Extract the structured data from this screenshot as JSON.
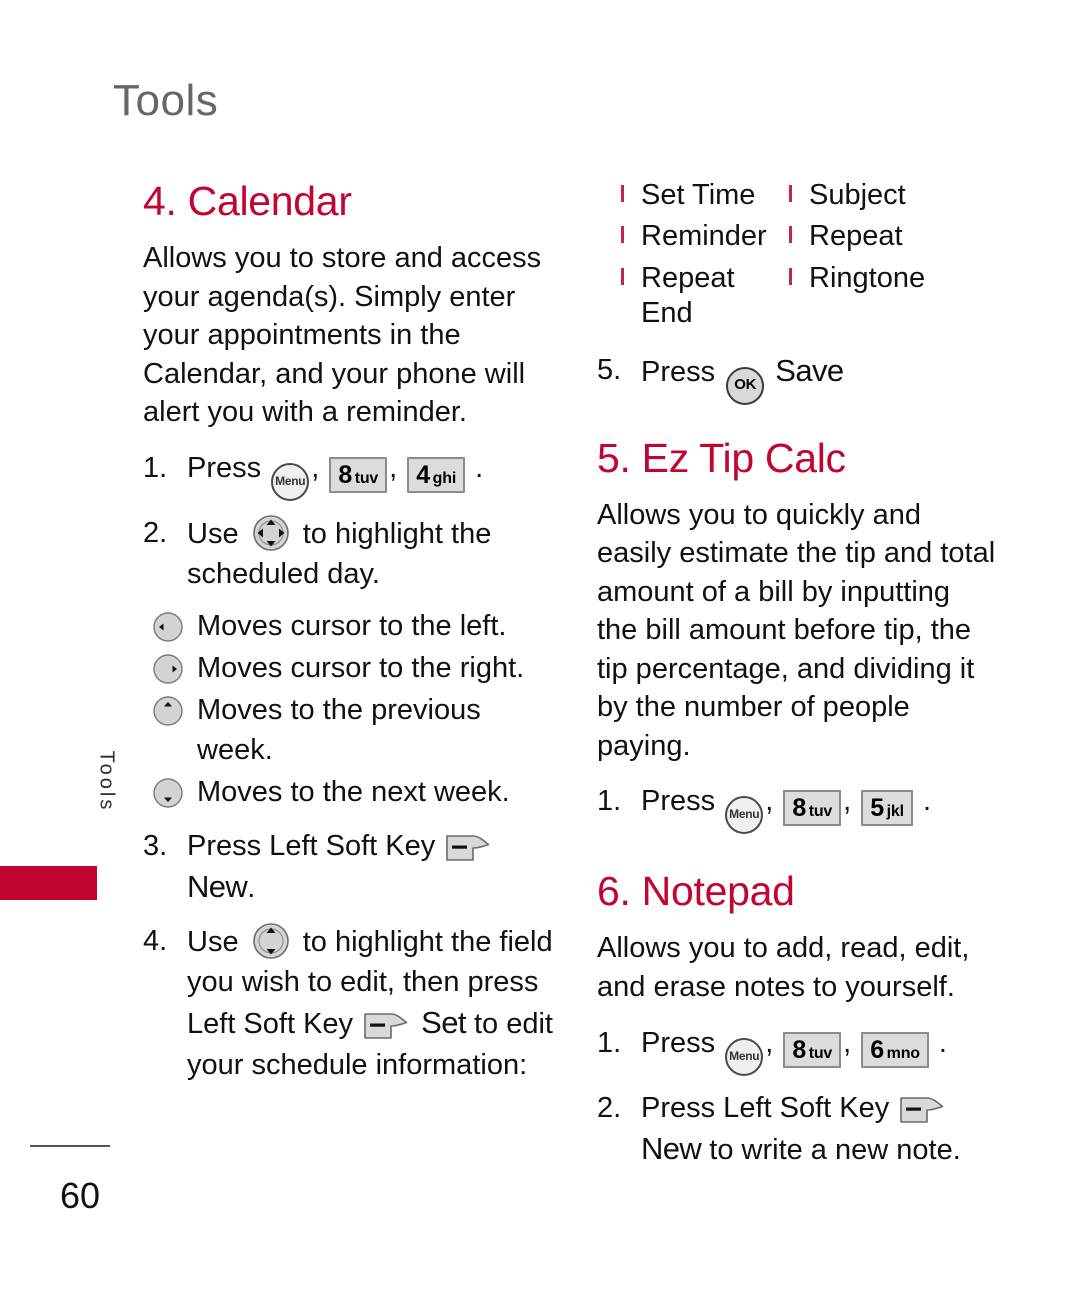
{
  "page": {
    "header_title": "Tools",
    "side_tab_label": "Tools",
    "page_number": "60",
    "accent_red": "#c20430",
    "header_grey": "#666666"
  },
  "calendar": {
    "heading": "4. Calendar",
    "intro": "Allows you to store and access your agenda(s). Simply enter your appointments in the Calendar, and your phone will alert you with a reminder.",
    "step1": {
      "num": "1.",
      "verb": "Press",
      "key_menu": "Menu",
      "key2_digit": "8",
      "key2_letters": "tuv",
      "key3_digit": "4",
      "key3_letters": "ghi",
      "comma": ",",
      "period": "."
    },
    "step2": {
      "num": "2.",
      "verb": "Use",
      "text": "to highlight the scheduled day."
    },
    "nav_items": [
      {
        "icon": "nav-left-icon",
        "text": "Moves cursor to the left."
      },
      {
        "icon": "nav-right-icon",
        "text": "Moves cursor to the right."
      },
      {
        "icon": "nav-up-icon",
        "text": "Moves to the previous week."
      },
      {
        "icon": "nav-down-icon",
        "text": "Moves to the next week."
      }
    ],
    "step3": {
      "num": "3.",
      "text_before": "Press Left Soft Key",
      "soft_label": "New",
      "text_after": "."
    },
    "step4": {
      "num": "4.",
      "verb": "Use",
      "text_mid": "to highlight the field you wish to edit, then press Left Soft Key",
      "soft_label": "Set",
      "text_after": "to edit your schedule information:"
    },
    "fields": [
      "Set Time",
      "Subject",
      "Reminder",
      "Repeat",
      "Repeat End",
      "Ringtone"
    ],
    "step5": {
      "num": "5.",
      "verb": "Press",
      "key_ok": "OK",
      "soft_label": "Save"
    }
  },
  "ez_tip_calc": {
    "heading": "5. Ez Tip Calc",
    "intro": "Allows you to quickly and easily estimate the tip and total amount of a bill by inputting the bill amount before tip, the tip percentage, and dividing it by the number of people paying.",
    "step1": {
      "num": "1.",
      "verb": "Press",
      "key_menu": "Menu",
      "key2_digit": "8",
      "key2_letters": "tuv",
      "key3_digit": "5",
      "key3_letters": "jkl",
      "comma": ",",
      "period": "."
    }
  },
  "notepad": {
    "heading": "6. Notepad",
    "intro": "Allows you to add, read, edit, and erase notes to yourself.",
    "step1": {
      "num": "1.",
      "verb": "Press",
      "key_menu": "Menu",
      "key2_digit": "8",
      "key2_letters": "tuv",
      "key3_digit": "6",
      "key3_letters": "mno",
      "comma": ",",
      "period": "."
    },
    "step2": {
      "num": "2.",
      "text_before": "Press Left Soft Key",
      "soft_label": "New",
      "text_after": "to write a new note."
    }
  }
}
